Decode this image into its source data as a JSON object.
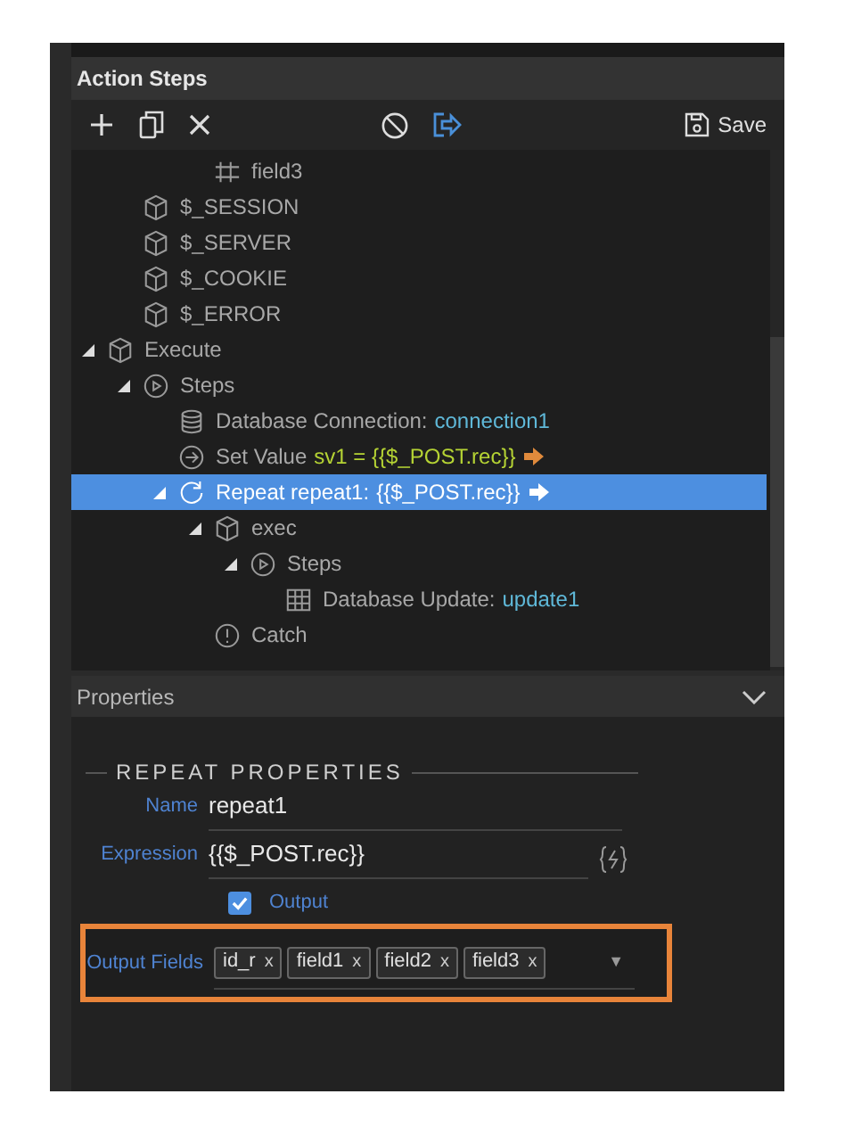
{
  "panel_title": "Action Steps",
  "toolbar": {
    "save_label": "Save"
  },
  "tree": [
    {
      "children": [
        {
          "children": [
            {
              "children": [
                {
                  "label": "field3",
                  "kind": "field",
                  "selected": false
                }
              ]
            }
          ]
        },
        {
          "label": "$_SESSION",
          "kind": "object",
          "selected": false
        },
        {
          "label": "$_SERVER",
          "kind": "object",
          "selected": false
        },
        {
          "label": "$_COOKIE",
          "kind": "object",
          "selected": false
        },
        {
          "label": "$_ERROR",
          "kind": "object",
          "selected": false
        }
      ]
    },
    {
      "label": "Execute",
      "kind": "object",
      "expanded": true,
      "selected": false,
      "children": [
        {
          "label": "Steps",
          "kind": "steps",
          "expanded": true,
          "selected": false,
          "children": [
            {
              "label": "Database Connection:",
              "value": "connection1",
              "kind": "connection",
              "selected": false
            },
            {
              "label": "Set Value",
              "value": "sv1 = {{$_POST.rec}}",
              "kind": "set_value",
              "output": true,
              "selected": false
            },
            {
              "label": "Repeat repeat1:",
              "value": "{{$_POST.rec}}",
              "kind": "repeat",
              "output": true,
              "expanded": true,
              "selected": true,
              "children": [
                {
                  "label": "exec",
                  "kind": "object",
                  "expanded": true,
                  "selected": false,
                  "children": [
                    {
                      "label": "Steps",
                      "kind": "steps",
                      "expanded": true,
                      "selected": false,
                      "children": [
                        {
                          "label": "Database Update:",
                          "value": "update1",
                          "kind": "update",
                          "selected": false
                        }
                      ]
                    }
                  ]
                },
                {
                  "label": "Catch",
                  "kind": "catch",
                  "selected": false
                }
              ]
            }
          ]
        }
      ]
    }
  ],
  "properties": {
    "title": "Properties",
    "expanded": true,
    "section": "REPEAT PROPERTIES",
    "name": {
      "label": "Name",
      "value": "repeat1"
    },
    "expression": {
      "label": "Expression",
      "value": "{{$_POST.rec}}"
    },
    "output": {
      "label": "Output",
      "checked": true
    },
    "output_fields": {
      "label": "Output Fields",
      "tags": [
        {
          "label": "id_r",
          "remove": "x"
        },
        {
          "label": "field1",
          "remove": "x"
        },
        {
          "label": "field2",
          "remove": "x"
        },
        {
          "label": "field3",
          "remove": "x"
        }
      ],
      "dropdown": "▼"
    }
  }
}
